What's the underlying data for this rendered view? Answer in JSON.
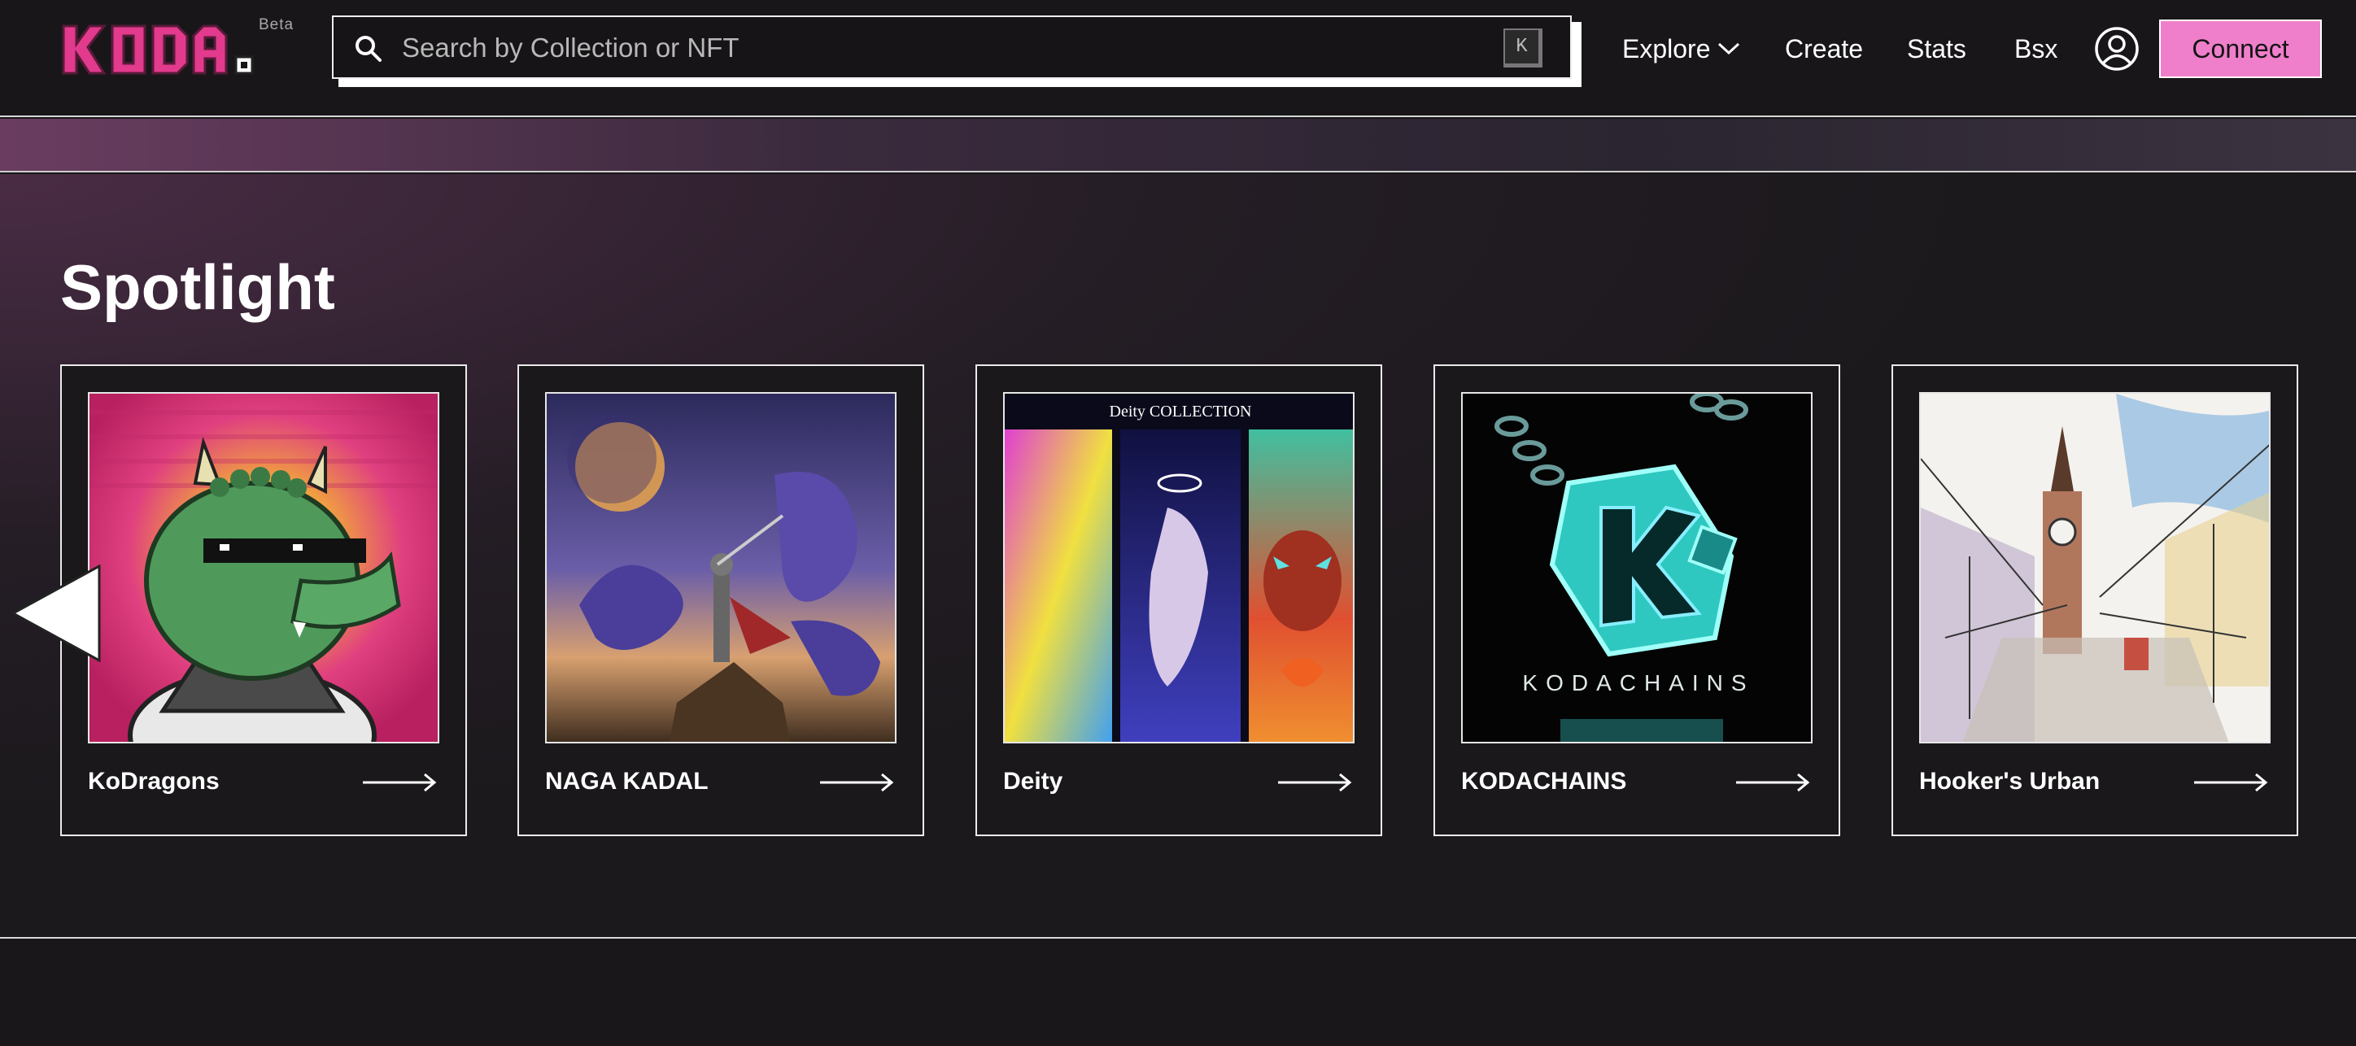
{
  "header": {
    "beta": "Beta",
    "search_placeholder": "Search by Collection or NFT",
    "search_shortcut": "K",
    "nav": {
      "explore": "Explore",
      "create": "Create",
      "stats": "Stats",
      "bsx": "Bsx"
    },
    "connect": "Connect"
  },
  "main": {
    "title": "Spotlight",
    "cards": [
      {
        "name": "KoDragons"
      },
      {
        "name": "NAGA KADAL"
      },
      {
        "name": "Deity"
      },
      {
        "name": "KODACHAINS"
      },
      {
        "name": "Hooker's Urban"
      }
    ],
    "deity_overlay": "Deity COLLECTION",
    "kodachains_overlay": "KODACHAINS"
  },
  "icons": {
    "logo": "koda-logo",
    "search": "search-icon",
    "chevron": "chevron-down-icon",
    "profile": "profile-icon",
    "arrow": "arrow-right-icon",
    "prev": "carousel-prev-icon"
  },
  "colors": {
    "accent": "#ef7fca",
    "logo_pink": "#e23a8c",
    "background": "#191719"
  }
}
